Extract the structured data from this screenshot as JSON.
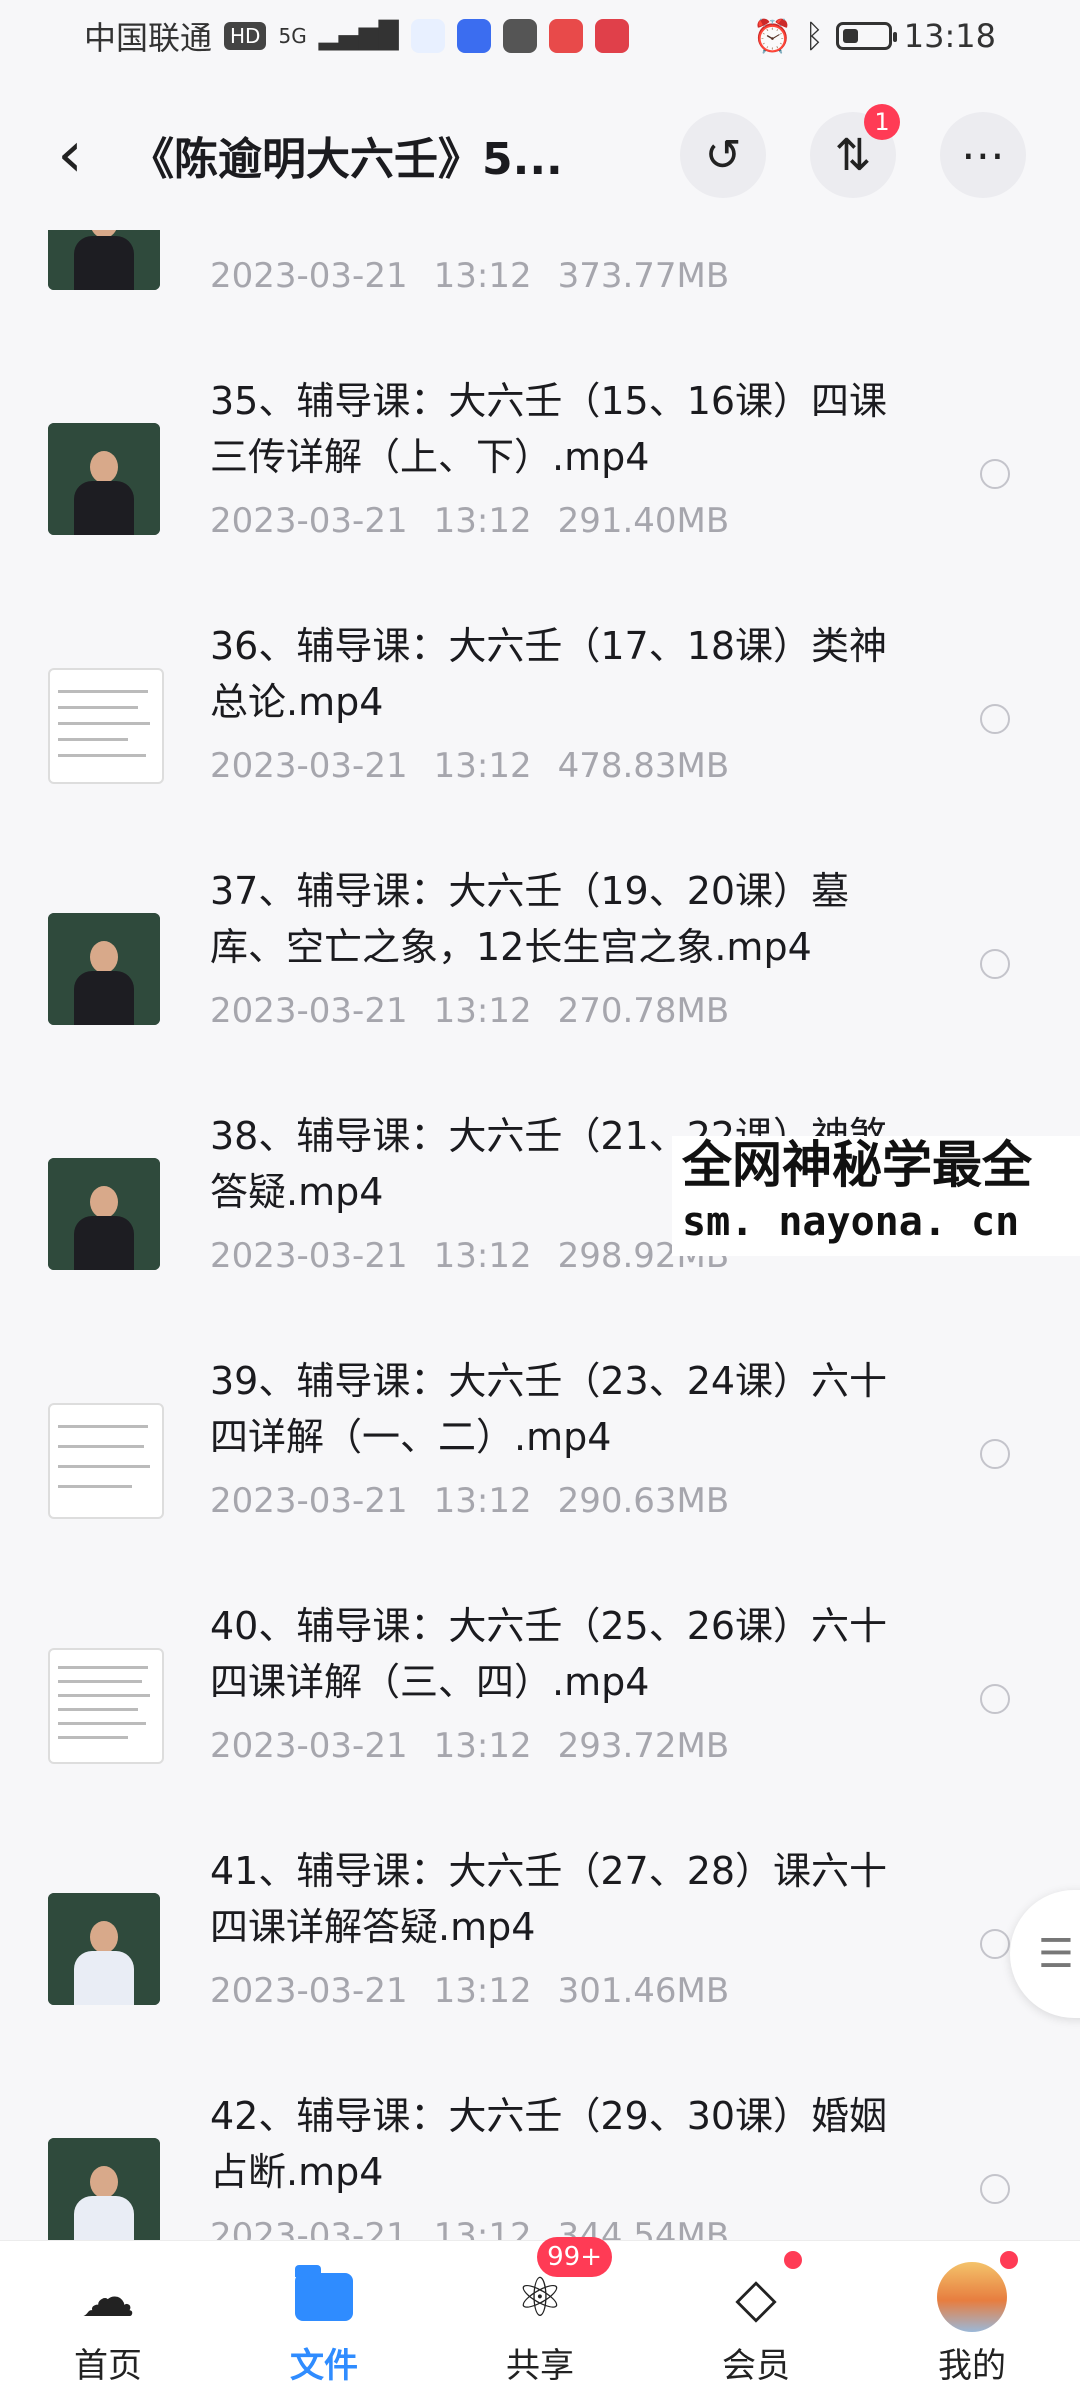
{
  "status": {
    "carrier": "中国联通",
    "hd": "HD",
    "network": "5G",
    "time": "13:18"
  },
  "header": {
    "title": "《陈逾明大六壬》5...",
    "transfer_badge": "1"
  },
  "files": [
    {
      "name": "",
      "date": "2023-03-21",
      "time": "13:12",
      "size": "373.77MB",
      "thumb": "video"
    },
    {
      "name": "35、辅导课：大六壬（15、16课）四课三传详解（上、下）.mp4",
      "date": "2023-03-21",
      "time": "13:12",
      "size": "291.40MB",
      "thumb": "video"
    },
    {
      "name": "36、辅导课：大六壬（17、18课）类神总论.mp4",
      "date": "2023-03-21",
      "time": "13:12",
      "size": "478.83MB",
      "thumb": "doc"
    },
    {
      "name": "37、辅导课：大六壬（19、20课）墓库、空亡之象，12长生宫之象.mp4",
      "date": "2023-03-21",
      "time": "13:12",
      "size": "270.78MB",
      "thumb": "video"
    },
    {
      "name": "38、辅导课：大六壬（21、22课）神煞答疑.mp4",
      "date": "2023-03-21",
      "time": "13:12",
      "size": "298.92MB",
      "thumb": "video"
    },
    {
      "name": "39、辅导课：大六壬（23、24课）六十四详解（一、二）.mp4",
      "date": "2023-03-21",
      "time": "13:12",
      "size": "290.63MB",
      "thumb": "doc"
    },
    {
      "name": "40、辅导课：大六壬（25、26课）六十四课详解（三、四）.mp4",
      "date": "2023-03-21",
      "time": "13:12",
      "size": "293.72MB",
      "thumb": "doc"
    },
    {
      "name": "41、辅导课：大六壬（27、28）课六十四课详解答疑.mp4",
      "date": "2023-03-21",
      "time": "13:12",
      "size": "301.46MB",
      "thumb": "video-light"
    },
    {
      "name": "42、辅导课：大六壬（29、30课）婚姻占断.mp4",
      "date": "2023-03-21",
      "time": "13:12",
      "size": "344.54MB",
      "thumb": "video-light"
    }
  ],
  "watermark": {
    "line1": "全网神秘学最全",
    "line2": "sm. nayona. cn"
  },
  "nav": {
    "home": "首页",
    "files": "文件",
    "share": "共享",
    "share_badge": "99+",
    "vip": "会员",
    "me": "我的"
  },
  "colors": {
    "accent": "#2f8cff",
    "badge": "#ff3b55",
    "meta_text": "#a6a6ad"
  }
}
